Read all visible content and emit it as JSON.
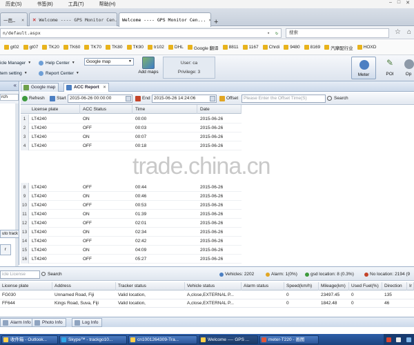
{
  "browser": {
    "menu": [
      "历史(S)",
      "书签(B)",
      "工具(T)",
      "帮助(H)"
    ],
    "tabs": [
      {
        "label": "一芭…",
        "active": false
      },
      {
        "label": "Welcome ---- GPS Monitor Cen...",
        "active": false
      },
      {
        "label": "Welcome ---- GPS Monitor Cen...",
        "active": true
      }
    ],
    "url": "n/default.aspx",
    "search_placeholder": "搜索",
    "bookmarks": [
      "gt02",
      "gt07",
      "TK20",
      "TK60",
      "TK70",
      "TK80",
      "TK90",
      "tr102",
      "DHL",
      "Google 翻译",
      "8811",
      "1167",
      "Chrdi",
      "9480",
      "8169",
      "汽摩配行业",
      "HOXD"
    ]
  },
  "app": {
    "menus": {
      "vehicle_manager": "icle Manager",
      "system_setting": "tem setting",
      "help_center": "Help Center",
      "report_center": "Report Center"
    },
    "map_select": "Google map",
    "add_maps": "Add maps",
    "user_line": "User: ca",
    "privilege_line": "Privilege: 3",
    "right_tools": [
      "Meter",
      "POI",
      "Op"
    ],
    "left_search": "rch",
    "auto_track": "uto track",
    "gr_label": "r",
    "tabs": [
      {
        "label": "Google map"
      },
      {
        "label": "ACC Report"
      }
    ]
  },
  "report": {
    "refresh": "Refresh",
    "start": "Start",
    "start_value": "2015-06-26 00:00:00",
    "end": "End",
    "end_value": "2015-06-26 14:24:06",
    "offset": "Offset",
    "offset_placeholder": "Please Enter the Offset Time(S)",
    "search": "Search",
    "columns": [
      "License plate",
      "ACC Status",
      "Time",
      "Date"
    ],
    "rows": [
      {
        "idx": "1",
        "plate": "LT4240",
        "status": "ON",
        "time": "00:00",
        "date": "2015-06-26"
      },
      {
        "idx": "2",
        "plate": "LT4240",
        "status": "OFF",
        "time": "00:03",
        "date": "2015-06-26"
      },
      {
        "idx": "3",
        "plate": "LT4240",
        "status": "ON",
        "time": "00:07",
        "date": "2015-06-26"
      },
      {
        "idx": "4",
        "plate": "LT4240",
        "status": "OFF",
        "time": "00:18",
        "date": "2015-06-26"
      },
      {
        "idx": "8",
        "plate": "LT4240",
        "status": "OFF",
        "time": "00:44",
        "date": "2015-06-26"
      },
      {
        "idx": "9",
        "plate": "LT4240",
        "status": "ON",
        "time": "00:46",
        "date": "2015-06-26"
      },
      {
        "idx": "10",
        "plate": "LT4240",
        "status": "OFF",
        "time": "00:53",
        "date": "2015-06-26"
      },
      {
        "idx": "11",
        "plate": "LT4240",
        "status": "ON",
        "time": "01:39",
        "date": "2015-06-26"
      },
      {
        "idx": "12",
        "plate": "LT4240",
        "status": "OFF",
        "time": "02:01",
        "date": "2015-06-26"
      },
      {
        "idx": "13",
        "plate": "LT4240",
        "status": "ON",
        "time": "02:34",
        "date": "2015-06-26"
      },
      {
        "idx": "14",
        "plate": "LT4240",
        "status": "OFF",
        "time": "02:42",
        "date": "2015-06-26"
      },
      {
        "idx": "15",
        "plate": "LT4240",
        "status": "ON",
        "time": "04:09",
        "date": "2015-06-26"
      },
      {
        "idx": "16",
        "plate": "LT4240",
        "status": "OFF",
        "time": "05:27",
        "date": "2015-06-26"
      }
    ],
    "watermark": "trade.china.cn"
  },
  "vehicles": {
    "search_placeholder": "icle License",
    "search_btn": "Search",
    "stats": {
      "vehicles": "Vehicles: 2202",
      "alarm": "Alarm: 1(0%)",
      "gps": "gsd location: 8 (0.3%)",
      "noloc": "No location: 2194 (9"
    },
    "columns": [
      "License plate",
      "Address",
      "Tracker status",
      "Vehicle status",
      "Alarm status",
      "Speed(km/h)",
      "Mileage(km)",
      "Used Fuel(%)",
      "Direction",
      "Ir"
    ],
    "rows": [
      {
        "plate": "FG030",
        "address": "Unnamed Road, Fiji",
        "tracker": "Valid location,",
        "vehicle": "A,close,EXTERNAL P...",
        "alarm": "",
        "speed": "0",
        "mileage": "23497.45",
        "fuel": "0",
        "direction": "135"
      },
      {
        "plate": "FF644",
        "address": "Kings Road, Suva, Fiji",
        "tracker": "Valid location,",
        "vehicle": "A,close,EXTERNAL P...",
        "alarm": "",
        "speed": "0",
        "mileage": "1842.48",
        "fuel": "0",
        "direction": "46"
      }
    ],
    "tabs": [
      "Alarm Info",
      "Photo Info",
      "Log Info"
    ]
  },
  "taskbar": [
    "收件箱 - Outlook...",
    "Skype™ - trackgo10...",
    "cn1001264309-Tra...",
    "Welcome ---- GPS ...",
    "meter-T220 - 画图"
  ]
}
